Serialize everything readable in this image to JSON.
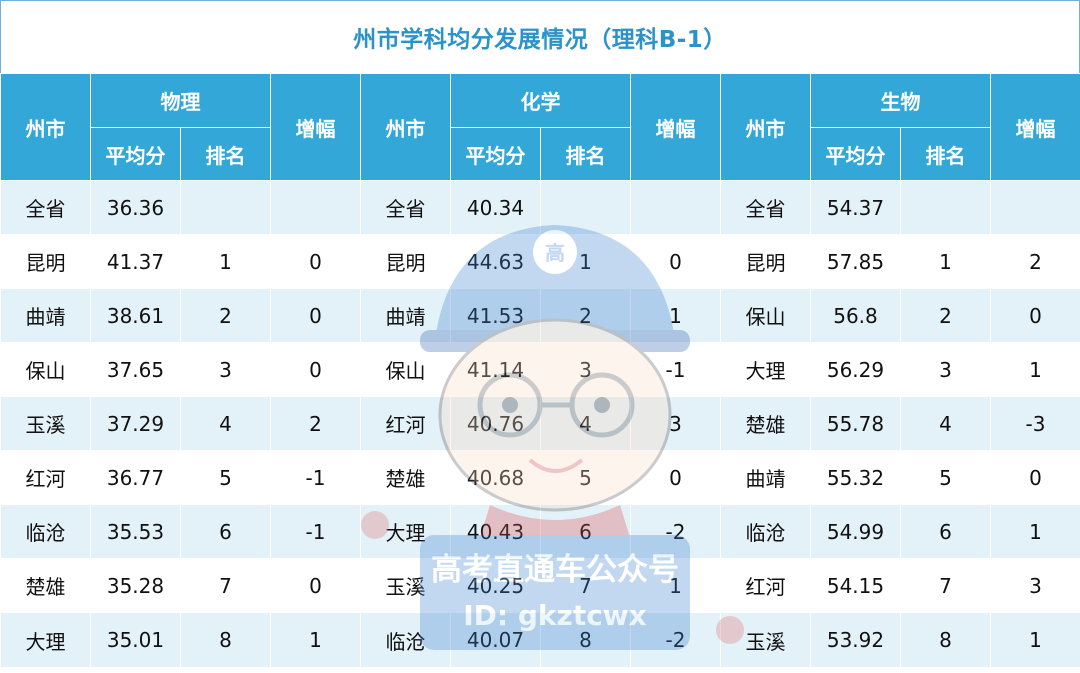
{
  "title": "州市学科均分发展情况（理科B-1）",
  "headers": {
    "city": "州市",
    "rise": "增幅",
    "avg": "平均分",
    "rank": "排名",
    "subjects": [
      "物理",
      "化学",
      "生物"
    ]
  },
  "rows": [
    {
      "physics": {
        "city": "全省",
        "avg": "36.36",
        "rank": "",
        "rise": ""
      },
      "chemistry": {
        "city": "全省",
        "avg": "40.34",
        "rank": "",
        "rise": ""
      },
      "biology": {
        "city": "全省",
        "avg": "54.37",
        "rank": "",
        "rise": ""
      }
    },
    {
      "physics": {
        "city": "昆明",
        "avg": "41.37",
        "rank": "1",
        "rise": "0"
      },
      "chemistry": {
        "city": "昆明",
        "avg": "44.63",
        "rank": "1",
        "rise": "0"
      },
      "biology": {
        "city": "昆明",
        "avg": "57.85",
        "rank": "1",
        "rise": "2"
      }
    },
    {
      "physics": {
        "city": "曲靖",
        "avg": "38.61",
        "rank": "2",
        "rise": "0"
      },
      "chemistry": {
        "city": "曲靖",
        "avg": "41.53",
        "rank": "2",
        "rise": "1"
      },
      "biology": {
        "city": "保山",
        "avg": "56.8",
        "rank": "2",
        "rise": "0"
      }
    },
    {
      "physics": {
        "city": "保山",
        "avg": "37.65",
        "rank": "3",
        "rise": "0"
      },
      "chemistry": {
        "city": "保山",
        "avg": "41.14",
        "rank": "3",
        "rise": "-1"
      },
      "biology": {
        "city": "大理",
        "avg": "56.29",
        "rank": "3",
        "rise": "1"
      }
    },
    {
      "physics": {
        "city": "玉溪",
        "avg": "37.29",
        "rank": "4",
        "rise": "2"
      },
      "chemistry": {
        "city": "红河",
        "avg": "40.76",
        "rank": "4",
        "rise": "3"
      },
      "biology": {
        "city": "楚雄",
        "avg": "55.78",
        "rank": "4",
        "rise": "-3"
      }
    },
    {
      "physics": {
        "city": "红河",
        "avg": "36.77",
        "rank": "5",
        "rise": "-1"
      },
      "chemistry": {
        "city": "楚雄",
        "avg": "40.68",
        "rank": "5",
        "rise": "0"
      },
      "biology": {
        "city": "曲靖",
        "avg": "55.32",
        "rank": "5",
        "rise": "0"
      }
    },
    {
      "physics": {
        "city": "临沧",
        "avg": "35.53",
        "rank": "6",
        "rise": "-1"
      },
      "chemistry": {
        "city": "大理",
        "avg": "40.43",
        "rank": "6",
        "rise": "-2"
      },
      "biology": {
        "city": "临沧",
        "avg": "54.99",
        "rank": "6",
        "rise": "1"
      }
    },
    {
      "physics": {
        "city": "楚雄",
        "avg": "35.28",
        "rank": "7",
        "rise": "0"
      },
      "chemistry": {
        "city": "玉溪",
        "avg": "40.25",
        "rank": "7",
        "rise": "1"
      },
      "biology": {
        "city": "红河",
        "avg": "54.15",
        "rank": "7",
        "rise": "3"
      }
    },
    {
      "physics": {
        "city": "大理",
        "avg": "35.01",
        "rank": "8",
        "rise": "1"
      },
      "chemistry": {
        "city": "临沧",
        "avg": "40.07",
        "rank": "8",
        "rise": "-2"
      },
      "biology": {
        "city": "玉溪",
        "avg": "53.92",
        "rank": "8",
        "rise": "1"
      }
    }
  ],
  "watermark": {
    "badge": "高",
    "line1": "高考直通车公众号",
    "line2": "ID: gkztcwx"
  },
  "colors": {
    "header": "#33a8d8",
    "title": "#2b93c9",
    "stripe": "#e3f1f8"
  }
}
